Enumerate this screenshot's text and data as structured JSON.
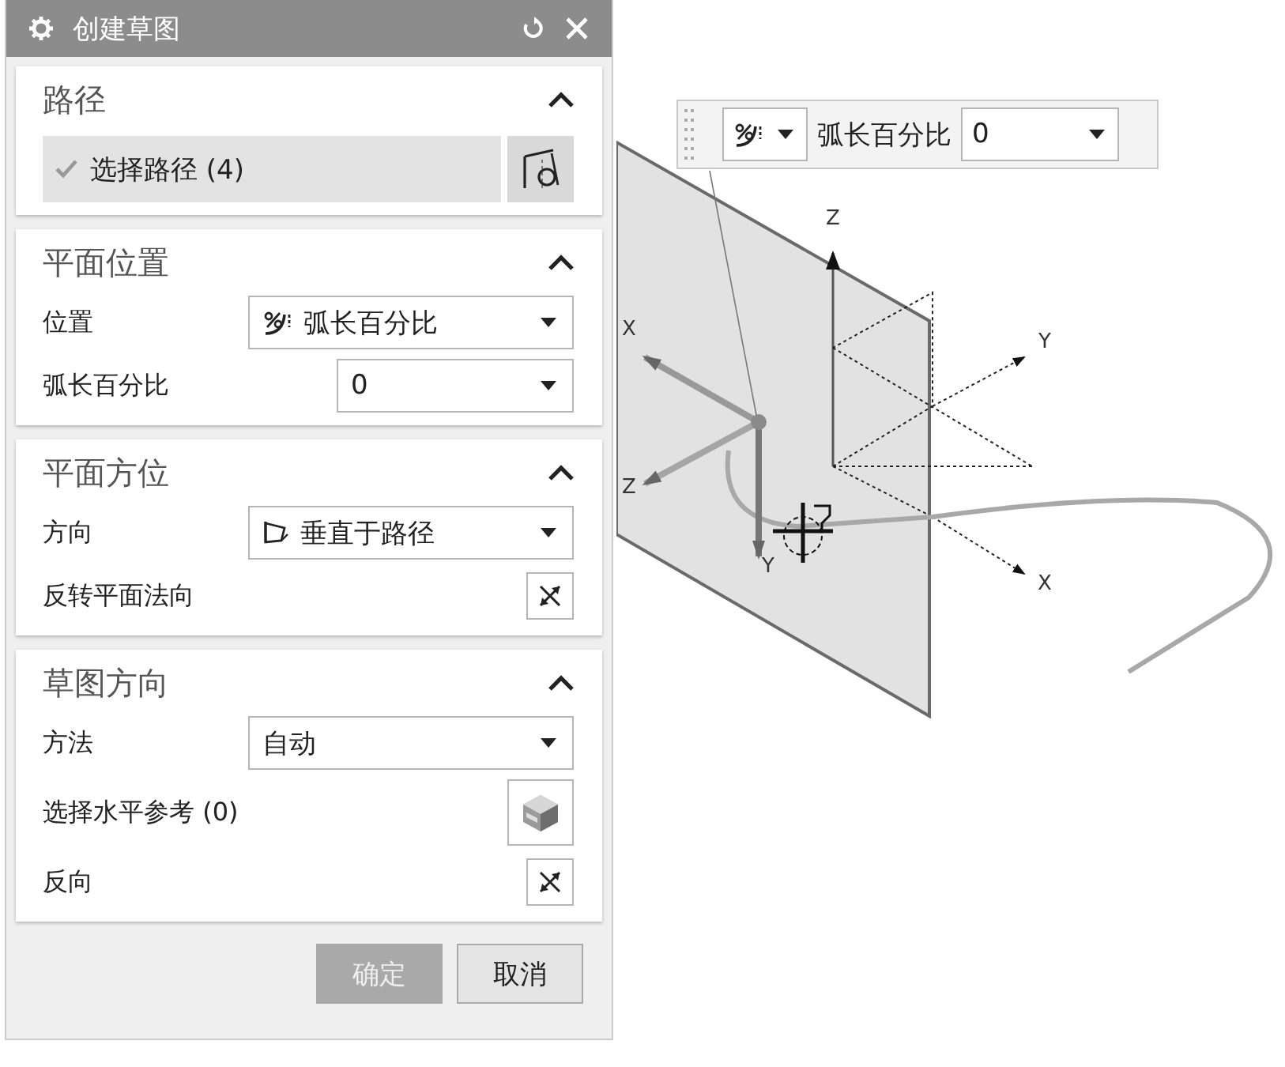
{
  "dialog": {
    "title": "创建草图",
    "sections": [
      {
        "title": "路径",
        "expanded": true,
        "rows": [
          {
            "kind": "path-selector",
            "label": "选择路径 (4)",
            "checked": true
          }
        ]
      },
      {
        "title": "平面位置",
        "expanded": true,
        "rows": [
          {
            "kind": "arc-dropdown",
            "label": "位置",
            "value": "弧长百分比"
          },
          {
            "kind": "short-dropdown",
            "label": "弧长百分比",
            "value": "0"
          }
        ]
      },
      {
        "title": "平面方位",
        "expanded": true,
        "rows": [
          {
            "kind": "plane-dropdown",
            "label": "方向",
            "value": "垂直于路径"
          },
          {
            "kind": "reverse-button",
            "label": "反转平面法向"
          }
        ]
      },
      {
        "title": "草图方向",
        "expanded": true,
        "rows": [
          {
            "kind": "dropdown",
            "label": "方法",
            "value": "自动"
          },
          {
            "kind": "face-selector",
            "label": "选择水平参考 (0)"
          },
          {
            "kind": "reverse-button",
            "label": "反向"
          }
        ]
      }
    ],
    "buttons": [
      {
        "label": "确定",
        "disabled": true
      },
      {
        "label": "取消",
        "disabled": false
      }
    ]
  },
  "toolbar": {
    "label": "弧长百分比",
    "value": "0"
  },
  "viewport": {
    "triad_labels": [
      "X",
      "Z",
      "Y"
    ],
    "csys_labels": [
      "Z",
      "Y",
      "X"
    ]
  }
}
